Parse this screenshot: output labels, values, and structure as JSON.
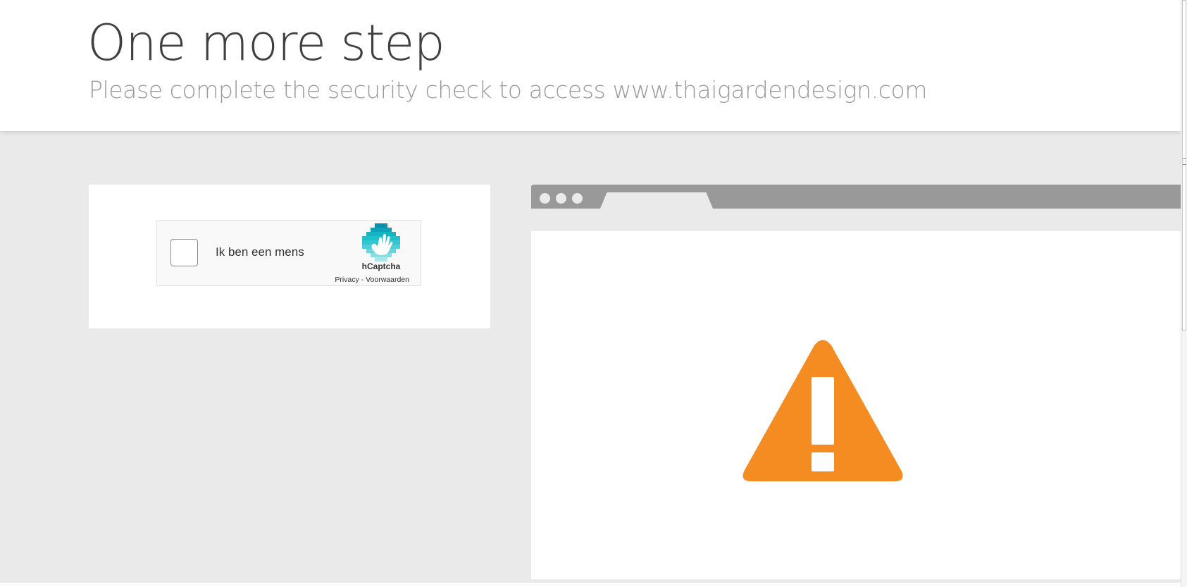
{
  "header": {
    "title": "One more step",
    "subtitle": "Please complete the security check to access www.thaigardendesign.com"
  },
  "captcha": {
    "checkbox_label": "Ik ben een mens",
    "checked": false,
    "brand": "hCaptcha",
    "privacy_link": "Privacy",
    "separator": " - ",
    "terms_link": "Voorwaarden",
    "logo_icon": "hcaptcha-hand-icon"
  },
  "illustration": {
    "icon": "warning-icon",
    "warning_color": "#f48c21"
  },
  "colors": {
    "background": "#eaeaea",
    "browser_bar": "#999999",
    "title_text": "#404040",
    "subtitle_text": "#9a9a9a"
  }
}
